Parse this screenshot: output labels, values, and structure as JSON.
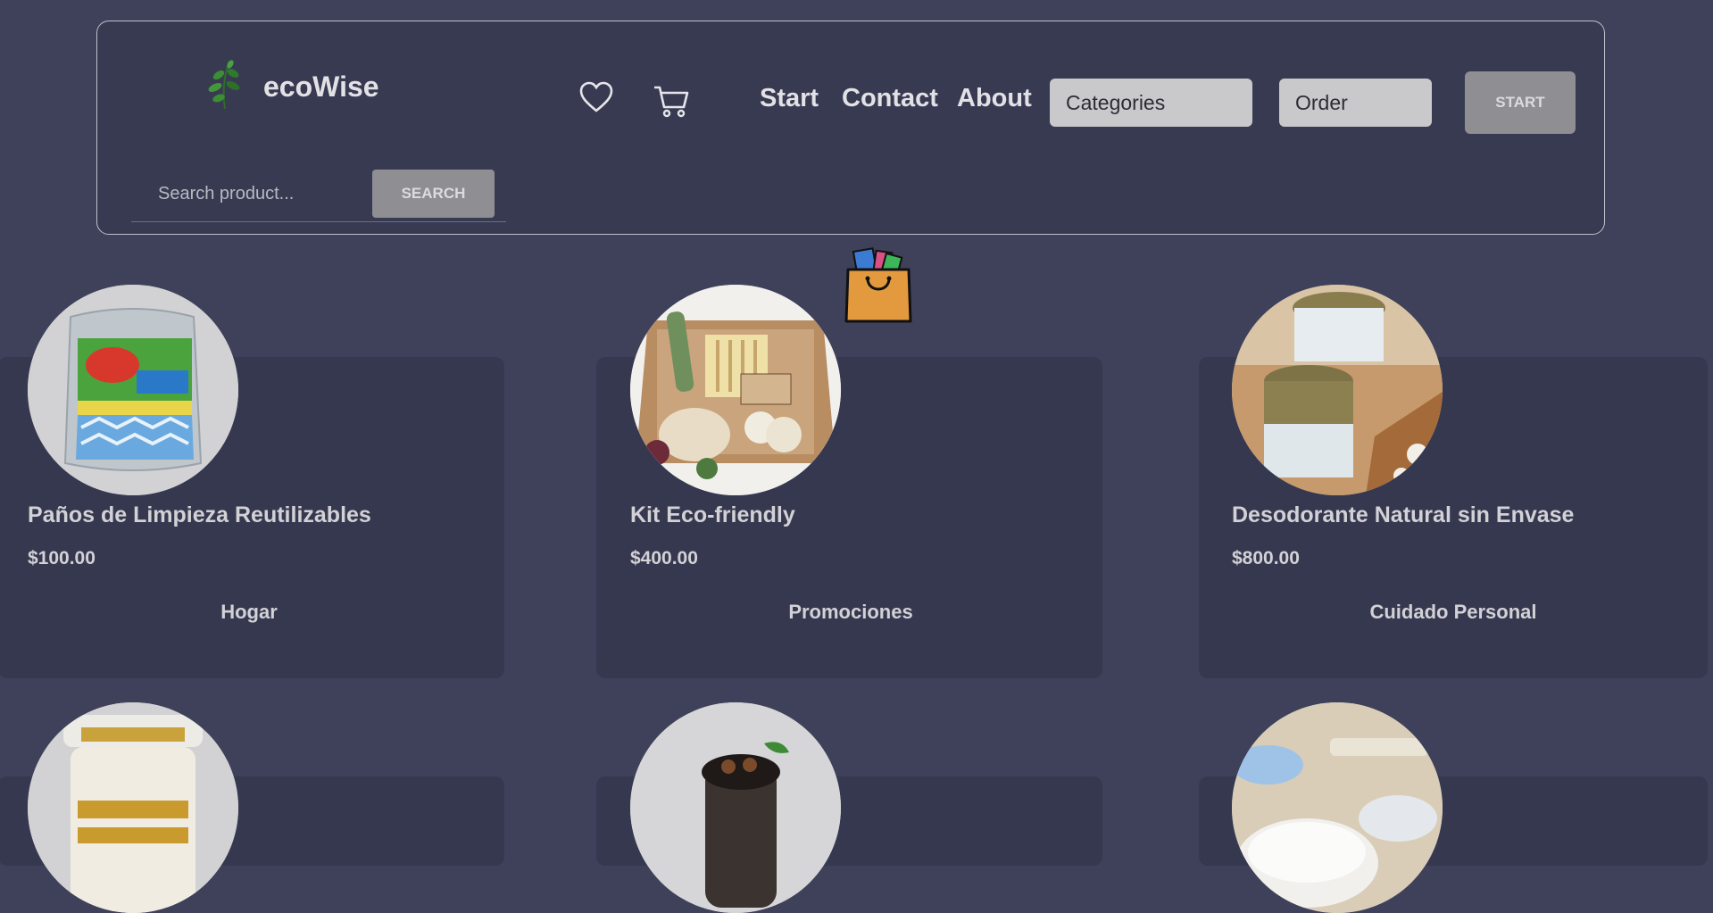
{
  "header": {
    "brand": "ecoWise",
    "nav": [
      "Start",
      "Contact",
      "About"
    ],
    "categories_select": "Categories",
    "order_select": "Order",
    "start_button": "START",
    "search_placeholder": "Search product...",
    "search_button": "SEARCH",
    "icons": [
      "leaf-logo-icon",
      "heart-icon",
      "cart-icon"
    ]
  },
  "shopping_bag_icon": "shopping-bag-icon",
  "products": [
    {
      "name": "Paños de Limpieza Reutilizables",
      "price": "$100.00",
      "category": "Hogar"
    },
    {
      "name": "Kit Eco-friendly",
      "price": "$400.00",
      "category": "Promociones"
    },
    {
      "name": "Desodorante Natural sin Envase",
      "price": "$800.00",
      "category": "Cuidado Personal"
    }
  ],
  "colors": {
    "background": "#3f415a",
    "card": "#363850",
    "button": "#8e8e93",
    "bag": "#e39a3f"
  }
}
